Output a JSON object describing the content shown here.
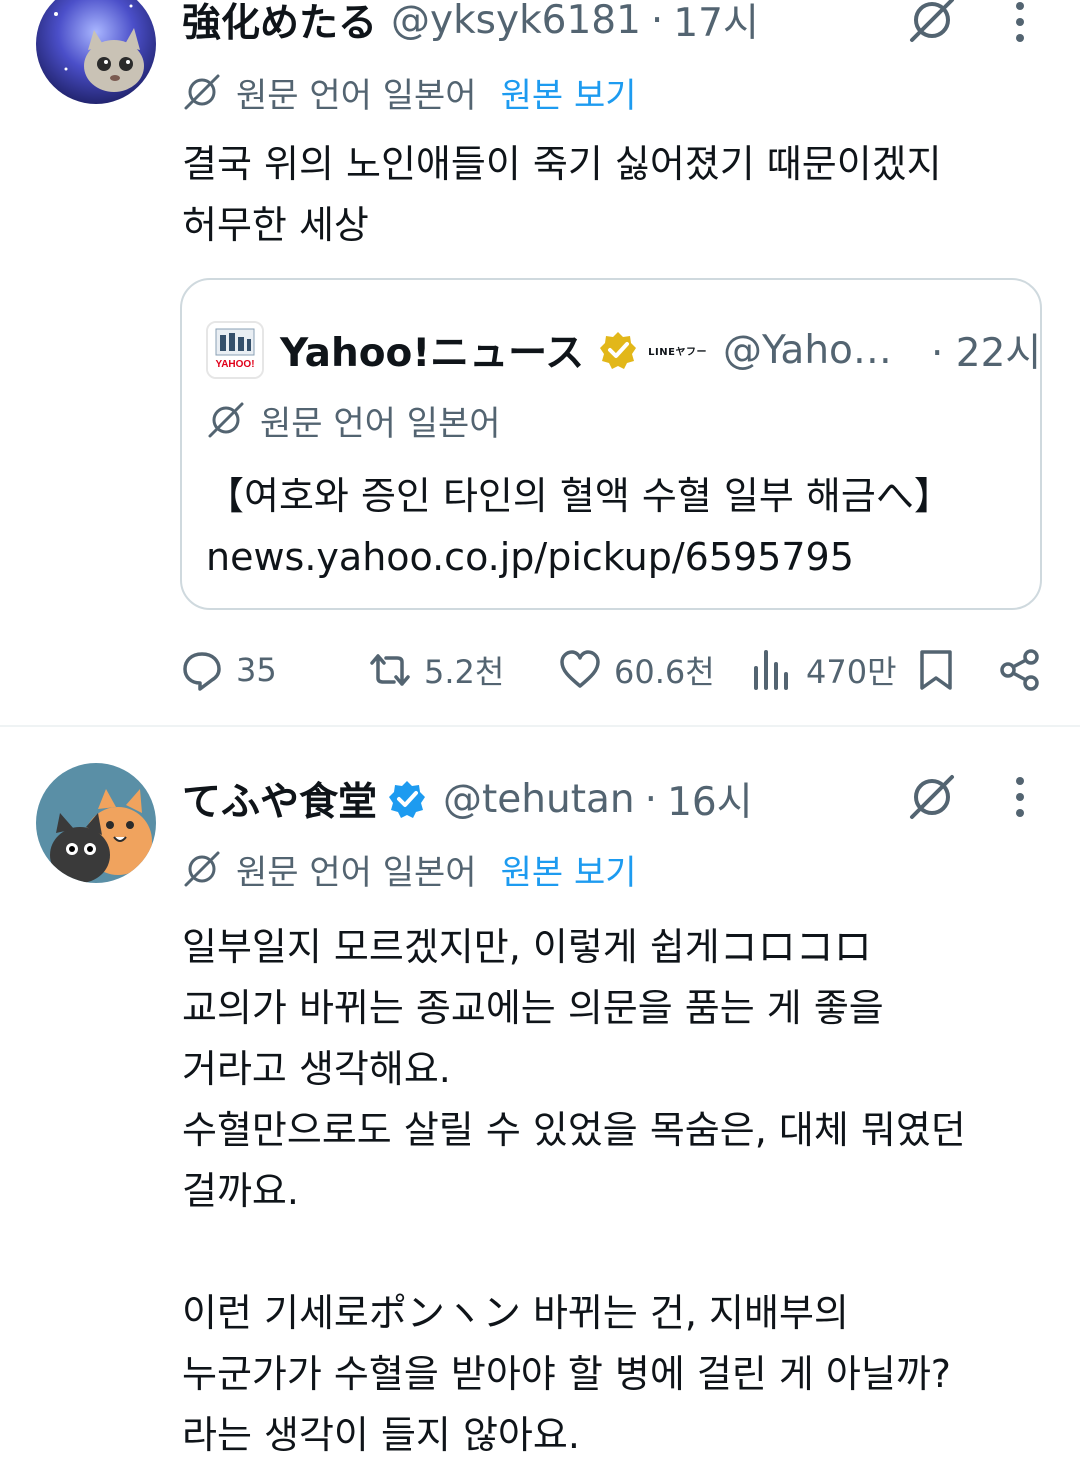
{
  "tweets": [
    {
      "display_name": "強化めたる",
      "handle": "@yksyk6181",
      "time": "17시",
      "translation_note": "원문 언어 일본어",
      "view_original": "원본 보기",
      "text": "결국 위의 노인애들이 죽기 싫어졌기 때문이겠지\n허무한 세상",
      "quote": {
        "display_name": "Yahoo!ニュース",
        "affiliate_badge": "LINEヤフー",
        "handle": "@Yaho…",
        "time": "· 22시",
        "translation_note": "원문 언어 일본어",
        "text": "【여호와 증인 타인의 혈액 수혈 일부 해금へ】\nnews.yahoo.co.jp/pickup/6595795",
        "avatar_text": "YAHOO!"
      },
      "stats": {
        "replies": "35",
        "reposts": "5.2천",
        "likes": "60.6천",
        "views": "470만"
      }
    },
    {
      "display_name": "てふや食堂",
      "handle": "@tehutan",
      "time": "16시",
      "translation_note": "원문 언어 일본어",
      "view_original": "원본 보기",
      "text": "일부일지 모르겠지만, 이렇게 쉽게コロコロ\n교의가 바뀌는 종교에는 의문을 품는 게 좋을\n거라고 생각해요.\n수혈만으로도 살릴 수 있었을 목숨은, 대체 뭐였던\n걸까요.\n\n이런 기세로ポンヽン 바뀌는 건, 지배부의\n누군가가 수혈을 받아야 할 병에 걸린 게 아닐까?\n라는 생각이 들지 않아요."
    }
  ],
  "colors": {
    "link": "#1d9bf0",
    "secondary_text": "#536471",
    "verified": "#1d9bf0",
    "gold_verified": "#e2b719"
  }
}
